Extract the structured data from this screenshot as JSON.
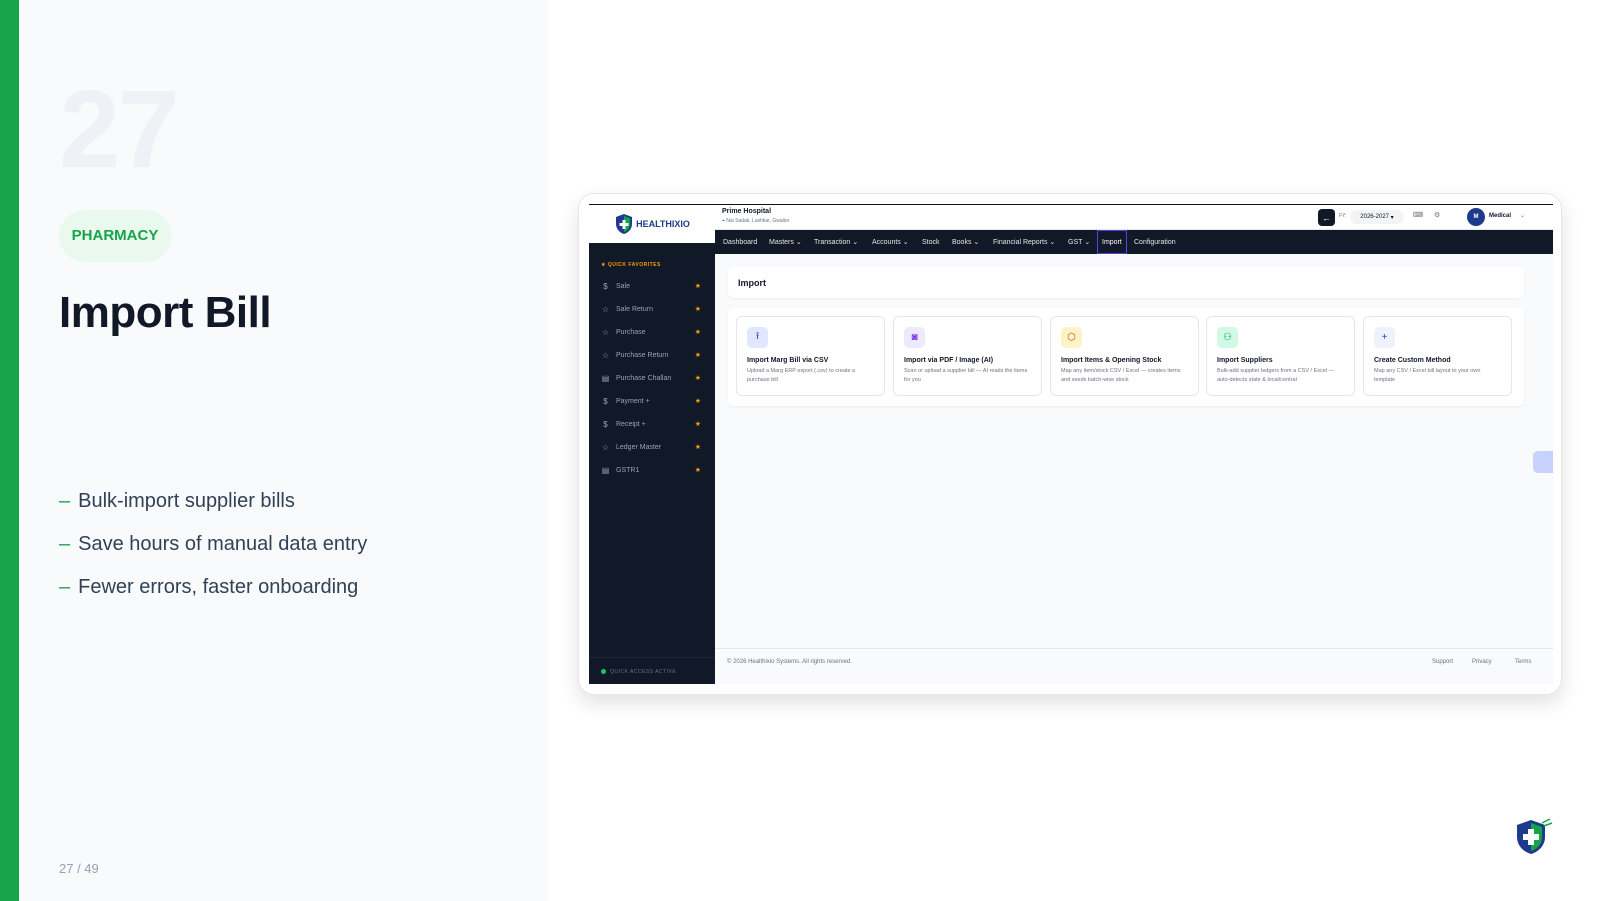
{
  "slide": {
    "number": "27",
    "category": "PHARMACY",
    "title": "Import Bill",
    "bullet_marker": "–",
    "bullets": [
      "Bulk-import supplier bills",
      "Save hours of manual data entry",
      "Fewer errors, faster onboarding"
    ],
    "page_counter": "27 / 49"
  },
  "app": {
    "logo_text": "HEALTHIXIO",
    "org_name": "Prime Hospital",
    "org_address": "Nai Sadak, Lashkar, Gwalior",
    "fy_label": "FY:",
    "fy_value": "2026-2027",
    "user_initial": "M",
    "user_label": "Medical",
    "nav": [
      "Dashboard",
      "Masters",
      "Transaction",
      "Accounts",
      "Stock",
      "Books",
      "Financial Reports",
      "GST",
      "Import",
      "Configuration"
    ],
    "active_nav": "Import",
    "sidebar_heading": "QUICK FAVORITES",
    "sidebar_items": [
      "Sale",
      "Sale Return",
      "Purchase",
      "Purchase Return",
      "Purchase Challan",
      "Payment +",
      "Receipt +",
      "Ledger Master",
      "GSTR1"
    ],
    "sidebar_footer": "QUICK ACCESS ACTIVE",
    "page_title": "Import",
    "cards": [
      {
        "title": "Import Marg Bill via CSV",
        "desc": "Upload a Marg ERP export (.csv) to create a purchase bill",
        "icon": "upload-icon",
        "icon_bg": "#e0e7ff",
        "icon_color": "#4f46e5"
      },
      {
        "title": "Import via PDF / Image (AI)",
        "desc": "Scan or upload a supplier bill — AI reads the items for you",
        "icon": "camera-icon",
        "icon_bg": "#ede9fe",
        "icon_color": "#7c3aed"
      },
      {
        "title": "Import Items & Opening Stock",
        "desc": "Map any item/stock CSV / Excel — creates items and seeds batch-wise stock",
        "icon": "box-icon",
        "icon_bg": "#fef3c7",
        "icon_color": "#b45309"
      },
      {
        "title": "Import Suppliers",
        "desc": "Bulk-add supplier ledgers from a CSV / Excel — auto-detects state & local/central",
        "icon": "users-icon",
        "icon_bg": "#d1fae5",
        "icon_color": "#059669"
      },
      {
        "title": "Create Custom Method",
        "desc": "Map any CSV / Excel bill layout to your own template",
        "icon": "plus-icon",
        "icon_bg": "#eef2ff",
        "icon_color": "#4338ca"
      }
    ],
    "footer_copyright": "© 2026 Healthixio Systems. All rights reserved.",
    "footer_links": [
      "Support",
      "Privacy",
      "Terms"
    ]
  },
  "colors": {
    "accent": "#16a34a",
    "sidebar_bg": "#111827",
    "star": "#f59e0b"
  }
}
